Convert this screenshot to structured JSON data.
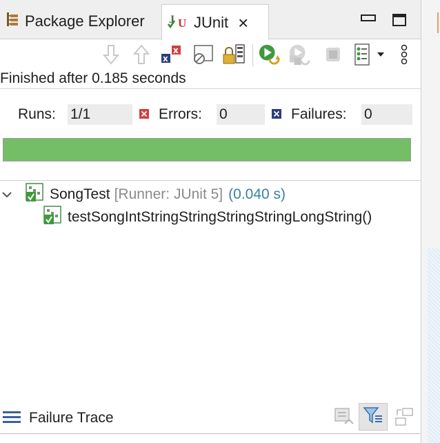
{
  "tabs": [
    {
      "label": "Package Explorer",
      "icon": "package-explorer-icon",
      "active": false
    },
    {
      "label": "JUnit",
      "icon": "junit-icon",
      "active": true,
      "close": "×"
    }
  ],
  "toolbar": {
    "items": [
      "next-failure-icon",
      "previous-failure-icon",
      "show-failures-only-icon",
      "show-skipped-only-icon",
      "scroll-lock-icon",
      "rerun-test-icon",
      "rerun-failed-first-icon",
      "stop-icon",
      "test-run-history-icon",
      "dropdown-arrow-icon",
      "view-menu-icon"
    ]
  },
  "status": "Finished after 0.185 seconds",
  "counters": {
    "runs_label": "Runs:",
    "runs_value": "1/1",
    "errors_label": "Errors:",
    "errors_value": "0",
    "failures_label": "Failures:",
    "failures_value": "0"
  },
  "progress": {
    "fraction": 1.0,
    "color": "#74be66"
  },
  "tree": {
    "suite": {
      "name": "SongTest",
      "runner": "[Runner: JUnit 5]",
      "time": "(0.040 s)"
    },
    "tests": [
      {
        "name": "testSongIntStringStringStringStringLongString()"
      }
    ]
  },
  "failure_trace": {
    "label": "Failure Trace"
  },
  "colors": {
    "progress_green": "#74be66",
    "error_red": "#d04040",
    "failure_blue": "#2c3e7a",
    "time_blue": "#3a7ea8"
  }
}
